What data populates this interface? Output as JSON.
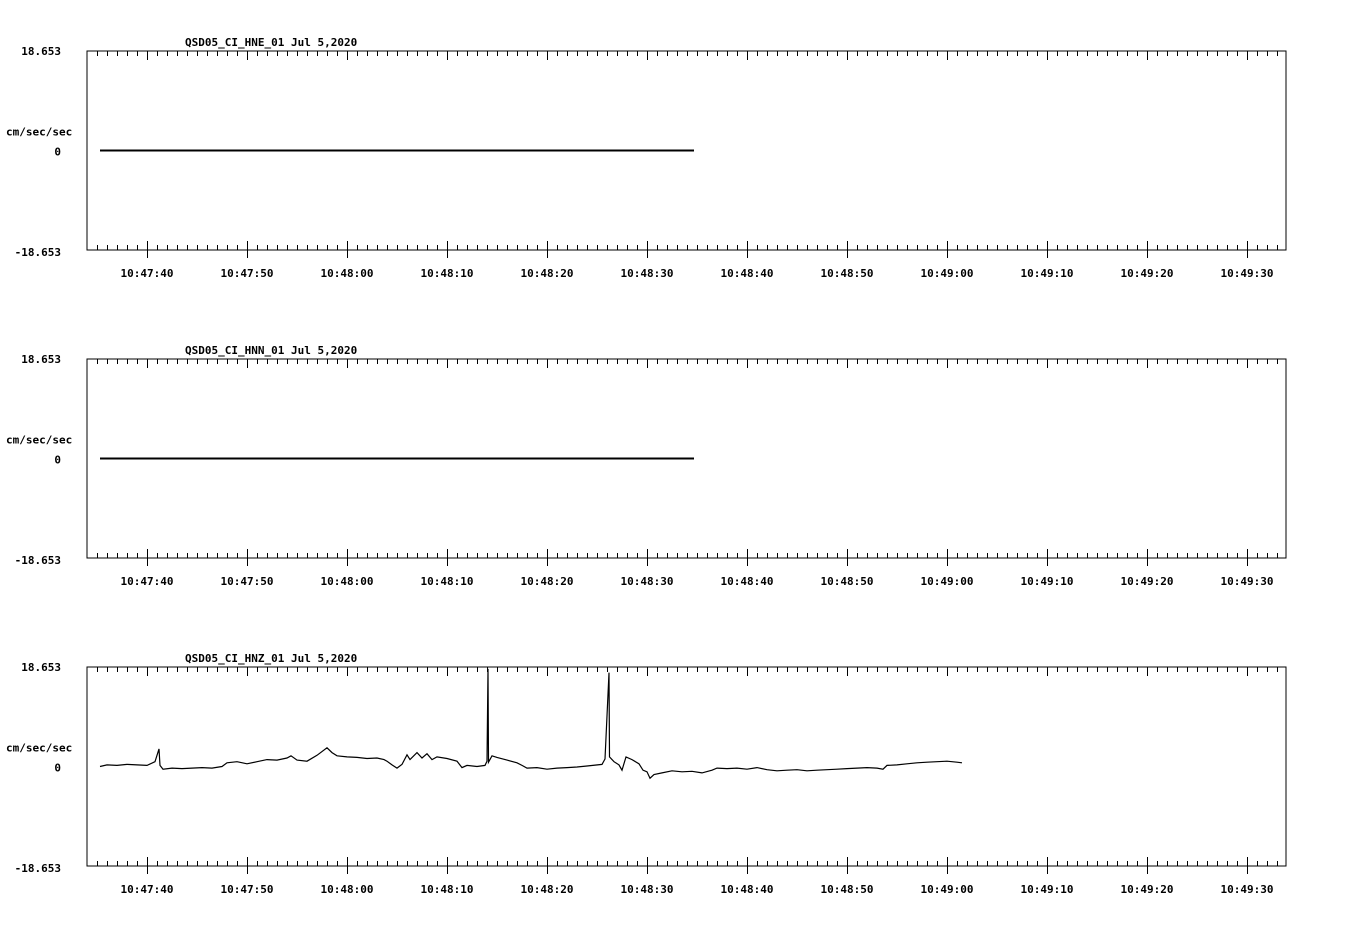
{
  "chart_data": [
    {
      "type": "line",
      "title": "QSD05_CI_HNE_01  Jul 5,2020",
      "ylabel": "cm/sec/sec",
      "ytick_labels": [
        "18.653",
        "0",
        "-18.653"
      ],
      "ylim": [
        -18.653,
        18.653
      ],
      "xtick_labels": [
        "10:47:40",
        "10:47:50",
        "10:48:00",
        "10:48:10",
        "10:48:20",
        "10:48:30",
        "10:48:40",
        "10:48:50",
        "10:49:00",
        "10:49:10",
        "10:49:20",
        "10:49:30"
      ],
      "x_range_seconds_after_10_47_40": [
        -4.7,
        54.7
      ],
      "series": [
        {
          "points": [
            [
              -4.7,
              0
            ],
            [
              54.7,
              0
            ]
          ]
        }
      ]
    },
    {
      "type": "line",
      "title": "QSD05_CI_HNN_01  Jul 5,2020",
      "ylabel": "cm/sec/sec",
      "ytick_labels": [
        "18.653",
        "0",
        "-18.653"
      ],
      "ylim": [
        -18.653,
        18.653
      ],
      "xtick_labels": [
        "10:47:40",
        "10:47:50",
        "10:48:00",
        "10:48:10",
        "10:48:20",
        "10:48:30",
        "10:48:40",
        "10:48:50",
        "10:49:00",
        "10:49:10",
        "10:49:20",
        "10:49:30"
      ],
      "x_range_seconds_after_10_47_40": [
        -4.7,
        54.7
      ],
      "series": [
        {
          "points": [
            [
              -4.7,
              0
            ],
            [
              54.7,
              0
            ]
          ]
        }
      ]
    },
    {
      "type": "line",
      "title": "QSD05_CI_HNZ_01  Jul 5,2020",
      "ylabel": "cm/sec/sec",
      "ytick_labels": [
        "18.653",
        "0",
        "-18.653"
      ],
      "ylim": [
        -18.653,
        18.653
      ],
      "xtick_labels": [
        "10:47:40",
        "10:47:50",
        "10:48:00",
        "10:48:10",
        "10:48:20",
        "10:48:30",
        "10:48:40",
        "10:48:50",
        "10:49:00",
        "10:49:10",
        "10:49:20",
        "10:49:30"
      ],
      "x_range_seconds_after_10_47_40": [
        -4.7,
        54.7
      ],
      "series": [
        {
          "points": [
            [
              -4.7,
              0.0
            ],
            [
              -4.0,
              0.3
            ],
            [
              -3.0,
              0.2
            ],
            [
              -2.0,
              0.4
            ],
            [
              -1.0,
              0.3
            ],
            [
              0.0,
              0.2
            ],
            [
              0.8,
              0.9
            ],
            [
              1.2,
              3.3
            ],
            [
              1.3,
              0.2
            ],
            [
              1.6,
              -0.5
            ],
            [
              2.5,
              -0.3
            ],
            [
              3.5,
              -0.4
            ],
            [
              4.5,
              -0.3
            ],
            [
              5.5,
              -0.2
            ],
            [
              6.5,
              -0.3
            ],
            [
              7.5,
              0.0
            ],
            [
              8.0,
              0.7
            ],
            [
              9.0,
              0.9
            ],
            [
              10.0,
              0.5
            ],
            [
              11.0,
              0.9
            ],
            [
              12.0,
              1.3
            ],
            [
              13.0,
              1.2
            ],
            [
              14.0,
              1.6
            ],
            [
              14.4,
              2.0
            ],
            [
              15.0,
              1.2
            ],
            [
              16.0,
              1.0
            ],
            [
              17.0,
              2.1
            ],
            [
              18.0,
              3.5
            ],
            [
              18.5,
              2.6
            ],
            [
              19.0,
              2.0
            ],
            [
              20.0,
              1.8
            ],
            [
              21.0,
              1.7
            ],
            [
              22.0,
              1.5
            ],
            [
              23.0,
              1.6
            ],
            [
              23.7,
              1.3
            ],
            [
              24.0,
              1.0
            ],
            [
              24.5,
              0.3
            ],
            [
              25.0,
              -0.3
            ],
            [
              25.5,
              0.4
            ],
            [
              26.0,
              2.2
            ],
            [
              26.3,
              1.3
            ],
            [
              27.0,
              2.6
            ],
            [
              27.5,
              1.6
            ],
            [
              28.0,
              2.4
            ],
            [
              28.5,
              1.3
            ],
            [
              29.0,
              1.8
            ],
            [
              30.0,
              1.5
            ],
            [
              31.0,
              1.0
            ],
            [
              31.5,
              -0.2
            ],
            [
              32.0,
              0.2
            ],
            [
              33.0,
              0.0
            ],
            [
              33.8,
              0.2
            ],
            [
              34.0,
              1.0
            ],
            [
              34.1,
              18.3
            ],
            [
              34.15,
              0.8
            ],
            [
              34.5,
              2.0
            ],
            [
              35.0,
              1.7
            ],
            [
              36.0,
              1.2
            ],
            [
              37.0,
              0.7
            ],
            [
              37.5,
              0.2
            ],
            [
              38.0,
              -0.3
            ],
            [
              39.0,
              -0.2
            ],
            [
              40.0,
              -0.5
            ],
            [
              41.0,
              -0.3
            ],
            [
              42.0,
              -0.2
            ],
            [
              43.0,
              -0.1
            ],
            [
              44.0,
              0.1
            ],
            [
              45.5,
              0.4
            ],
            [
              45.8,
              1.4
            ],
            [
              46.2,
              17.6
            ],
            [
              46.25,
              1.8
            ],
            [
              46.7,
              0.9
            ],
            [
              47.2,
              0.3
            ],
            [
              47.5,
              -0.7
            ],
            [
              47.9,
              1.8
            ],
            [
              48.5,
              1.3
            ],
            [
              49.2,
              0.5
            ],
            [
              49.6,
              -0.7
            ],
            [
              50.0,
              -1.0
            ],
            [
              50.3,
              -2.2
            ],
            [
              50.7,
              -1.5
            ],
            [
              51.5,
              -1.2
            ],
            [
              52.5,
              -0.8
            ],
            [
              53.5,
              -1.0
            ],
            [
              54.5,
              -0.9
            ],
            [
              55.5,
              -1.2
            ],
            [
              56.5,
              -0.7
            ],
            [
              57.0,
              -0.3
            ],
            [
              58.0,
              -0.4
            ],
            [
              59.0,
              -0.3
            ],
            [
              60.0,
              -0.5
            ],
            [
              61.0,
              -0.2
            ],
            [
              62.0,
              -0.6
            ],
            [
              63.0,
              -0.8
            ],
            [
              64.0,
              -0.7
            ],
            [
              65.0,
              -0.6
            ],
            [
              66.0,
              -0.8
            ],
            [
              67.0,
              -0.7
            ],
            [
              68.0,
              -0.6
            ],
            [
              69.0,
              -0.5
            ],
            [
              70.0,
              -0.4
            ],
            [
              71.0,
              -0.3
            ],
            [
              72.0,
              -0.2
            ],
            [
              73.0,
              -0.3
            ],
            [
              73.6,
              -0.5
            ],
            [
              74.0,
              0.2
            ],
            [
              75.0,
              0.3
            ],
            [
              76.0,
              0.5
            ],
            [
              77.0,
              0.7
            ],
            [
              78.0,
              0.8
            ],
            [
              79.0,
              0.9
            ],
            [
              80.0,
              1.0
            ],
            [
              80.5,
              0.9
            ],
            [
              81.0,
              0.8
            ],
            [
              81.5,
              0.7
            ]
          ]
        }
      ]
    }
  ]
}
